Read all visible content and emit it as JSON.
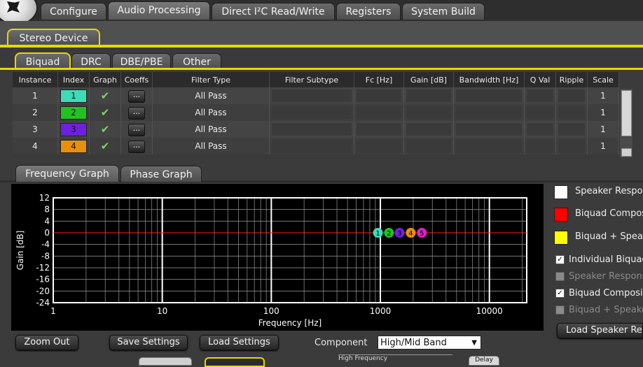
{
  "main_tabs": [
    "Configure",
    "Audio Processing",
    "Direct I²C Read/Write",
    "Registers",
    "System Build"
  ],
  "device_tab": "Stereo Device",
  "sub_tabs": [
    "Biquad",
    "DRC",
    "DBE/PBE",
    "Other"
  ],
  "table": {
    "headers": [
      "Instance",
      "Index",
      "Graph",
      "Coeffs",
      "Filter Type",
      "Filter Subtype",
      "Fc [Hz]",
      "Gain [dB]",
      "Bandwidth [Hz]",
      "Q Val",
      "Ripple",
      "Scale"
    ],
    "rows": [
      {
        "instance": "1",
        "index": "1",
        "color": "#3ddbb8",
        "coeffs": "...",
        "filter_type": "All Pass",
        "scale": "1"
      },
      {
        "instance": "2",
        "index": "2",
        "color": "#22c122",
        "coeffs": "...",
        "filter_type": "All Pass",
        "scale": "1"
      },
      {
        "instance": "3",
        "index": "3",
        "color": "#6e20e0",
        "coeffs": "...",
        "filter_type": "All Pass",
        "scale": "1"
      },
      {
        "instance": "4",
        "index": "4",
        "color": "#e8900c",
        "coeffs": "...",
        "filter_type": "All Pass",
        "scale": "1"
      }
    ]
  },
  "graph_tabs": [
    "Frequency Graph",
    "Phase Graph"
  ],
  "chart_data": {
    "type": "line",
    "xlabel": "Frequency [Hz]",
    "ylabel": "Gain [dB]",
    "xscale": "log",
    "xlim": [
      1,
      22000
    ],
    "ylim": [
      -24,
      12
    ],
    "yticks": [
      12,
      8,
      4,
      0,
      -4,
      -8,
      -12,
      -16,
      -20,
      -24
    ],
    "xticks": [
      1,
      10,
      100,
      1000,
      10000
    ],
    "series": [
      {
        "name": "Biquad Composite",
        "color": "#ff2020",
        "x": [
          1,
          22000
        ],
        "y": [
          0,
          0
        ]
      }
    ],
    "markers": [
      {
        "label": "1",
        "x": 950,
        "y": 0,
        "color": "#3ddbb8"
      },
      {
        "label": "2",
        "x": 1200,
        "y": 0,
        "color": "#22c122"
      },
      {
        "label": "3",
        "x": 1500,
        "y": 0,
        "color": "#6e20e0"
      },
      {
        "label": "4",
        "x": 1900,
        "y": 0,
        "color": "#e8900c"
      },
      {
        "label": "5",
        "x": 2400,
        "y": 0,
        "color": "#e020c8"
      }
    ],
    "grid": true
  },
  "legend": [
    {
      "label": "Speaker Response",
      "color": "#ffffff"
    },
    {
      "label": "Biquad Composite",
      "color": "#ff0000"
    },
    {
      "label": "Biquad + Speaker",
      "color": "#ffff00"
    }
  ],
  "checkboxes": [
    {
      "label": "Individual Biquads",
      "checked": true,
      "enabled": true
    },
    {
      "label": "Speaker Response",
      "checked": false,
      "enabled": false
    },
    {
      "label": "Biquad Composite",
      "checked": true,
      "enabled": true
    },
    {
      "label": "Biquad + Speaker",
      "checked": false,
      "enabled": false
    }
  ],
  "buttons": {
    "load_speaker": "Load Speaker Response",
    "zoom_out": "Zoom Out",
    "save_settings": "Save Settings",
    "load_settings": "Load Settings"
  },
  "component": {
    "label": "Component",
    "value": "High/Mid Band"
  },
  "bottom_partial": {
    "high_frequency": "High Frequency",
    "delay": "Delay"
  }
}
